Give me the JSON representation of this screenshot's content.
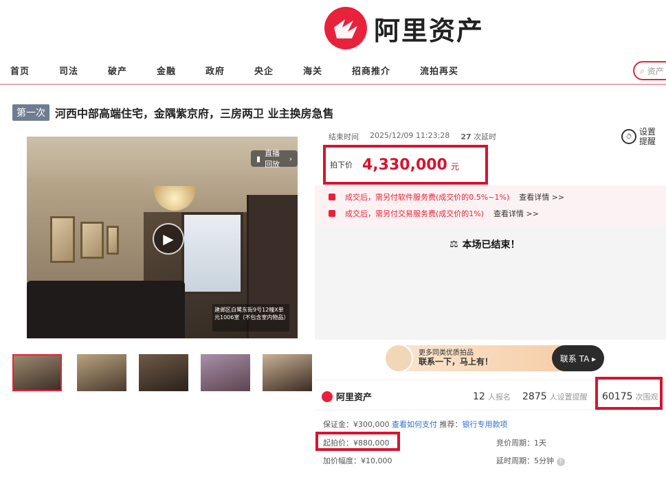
{
  "brand": {
    "name": "阿里资产",
    "accent": "#e8223a"
  },
  "nav": {
    "items": [
      "首页",
      "司法",
      "破产",
      "金融",
      "政府",
      "央企",
      "海关",
      "招商推介",
      "流拍再买"
    ],
    "search_placeholder": "资产"
  },
  "listing": {
    "round": "第一次",
    "title": "河西中部高端住宅，金隅紫京府，三房两卫 业主换房急售"
  },
  "media": {
    "replay_label": "直播回放",
    "caption": "建邺区白鹭东街9号12幢X单元1006室（不包含室内物品）",
    "thumb_count": 5
  },
  "auction": {
    "end_label": "结束时间",
    "end_time": "2025/12/09 11:23:28",
    "delay_count": "27",
    "delay_label": "次延时",
    "remind_label": "设置提醒",
    "price_label": "拍下价",
    "price": "4,330,000",
    "price_unit": "元",
    "fees": [
      {
        "text": "成交后，需另付软件服务费(成交价的0.5%~1%)",
        "link": "查看详情 >>"
      },
      {
        "text": "成交后，需另付交易服务费(成交价的1%)",
        "link": "查看详情 >>"
      }
    ],
    "ended_text": "本场已结束！"
  },
  "contact": {
    "line1": "更多同类优质拍品",
    "line2": "联系一下，马上有！",
    "button": "联系 TA ▸"
  },
  "stats": {
    "brand": "阿里资产",
    "signups": "12",
    "signups_label": "人报名",
    "reminders": "2875",
    "reminders_label": "人设置提醒",
    "views": "60175",
    "views_label": "次围观"
  },
  "details": {
    "deposit": "保证金：¥300,000",
    "how_pay": "查看如何支付",
    "recommend_label": "推荐：",
    "recommend_link": "银行专用款项",
    "start_price": "起拍价：¥880,000",
    "increment": "加价幅度：¥10,000",
    "bid_cycle": "竞价周期：1天",
    "delay_cycle": "延时周期：5分钟"
  }
}
